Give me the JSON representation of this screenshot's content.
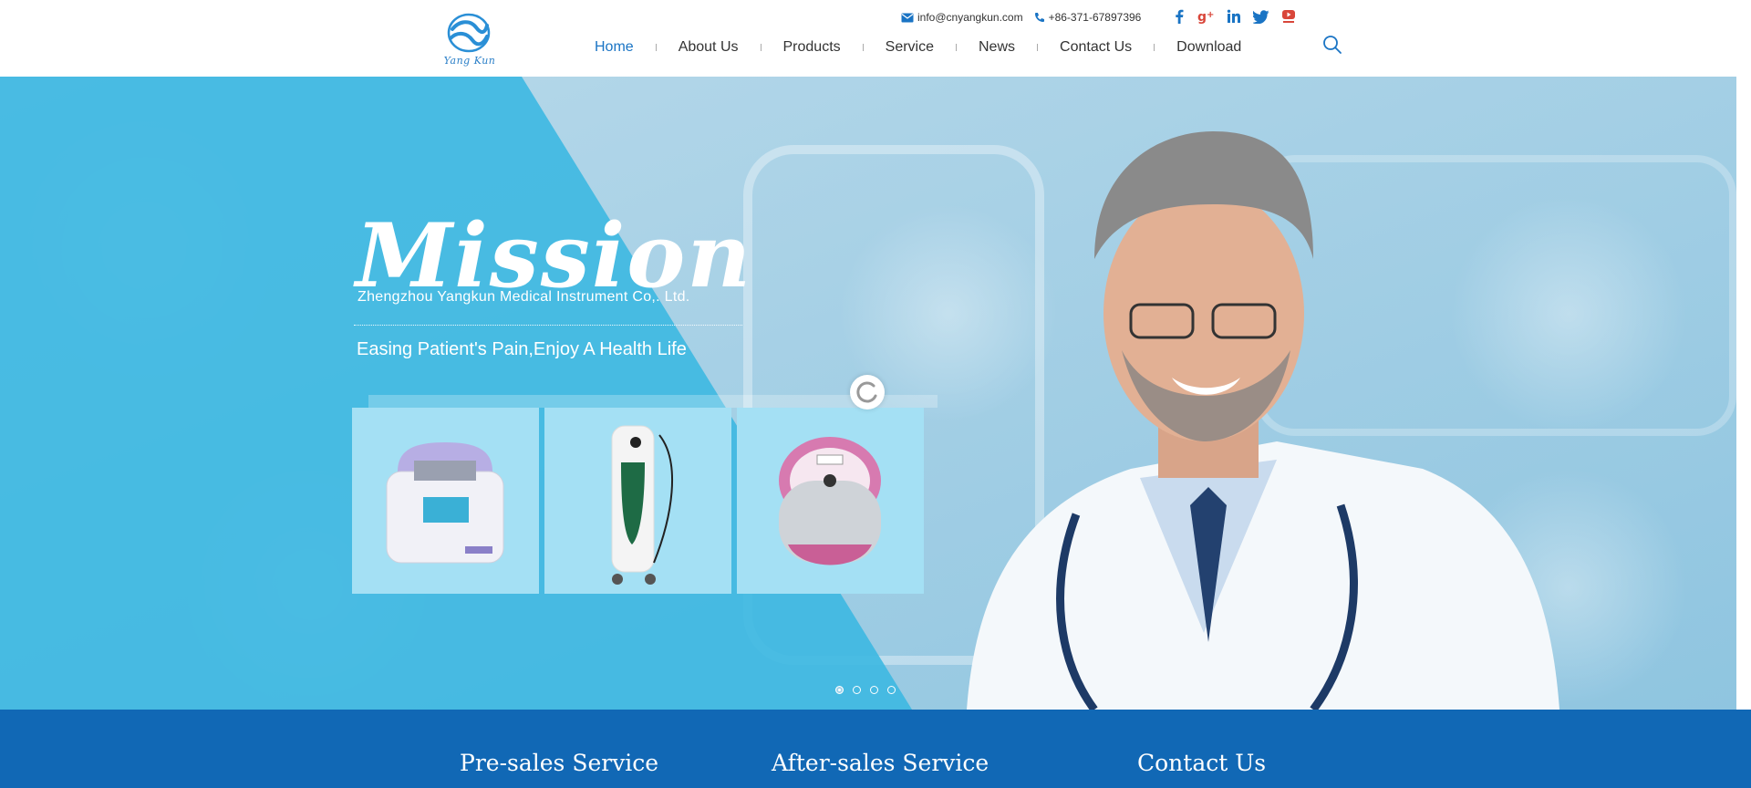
{
  "brand": {
    "logo_text": "Yang Kun",
    "accent": "#1a74c4",
    "footer_blue": "#1168b5"
  },
  "topbar": {
    "email": "info@cnyangkun.com",
    "phone": "+86-371-67897396"
  },
  "social": [
    "facebook-icon",
    "google-plus-icon",
    "linkedin-icon",
    "twitter-icon",
    "youtube-icon"
  ],
  "nav": {
    "items": [
      {
        "label": "Home",
        "active": true
      },
      {
        "label": "About Us"
      },
      {
        "label": "Products"
      },
      {
        "label": "Service"
      },
      {
        "label": "News"
      },
      {
        "label": "Contact Us"
      },
      {
        "label": "Download"
      }
    ]
  },
  "banner": {
    "title": "Mission",
    "company": "Zhengzhou Yangkun Medical Instrument Co,. Ltd.",
    "slogan": "Easing Patient's Pain,Enjoy A Health Life",
    "slides_total": 4,
    "slide_current": 1
  },
  "services": {
    "items": [
      "Pre-sales Service",
      "After-sales Service",
      "Contact Us"
    ]
  }
}
